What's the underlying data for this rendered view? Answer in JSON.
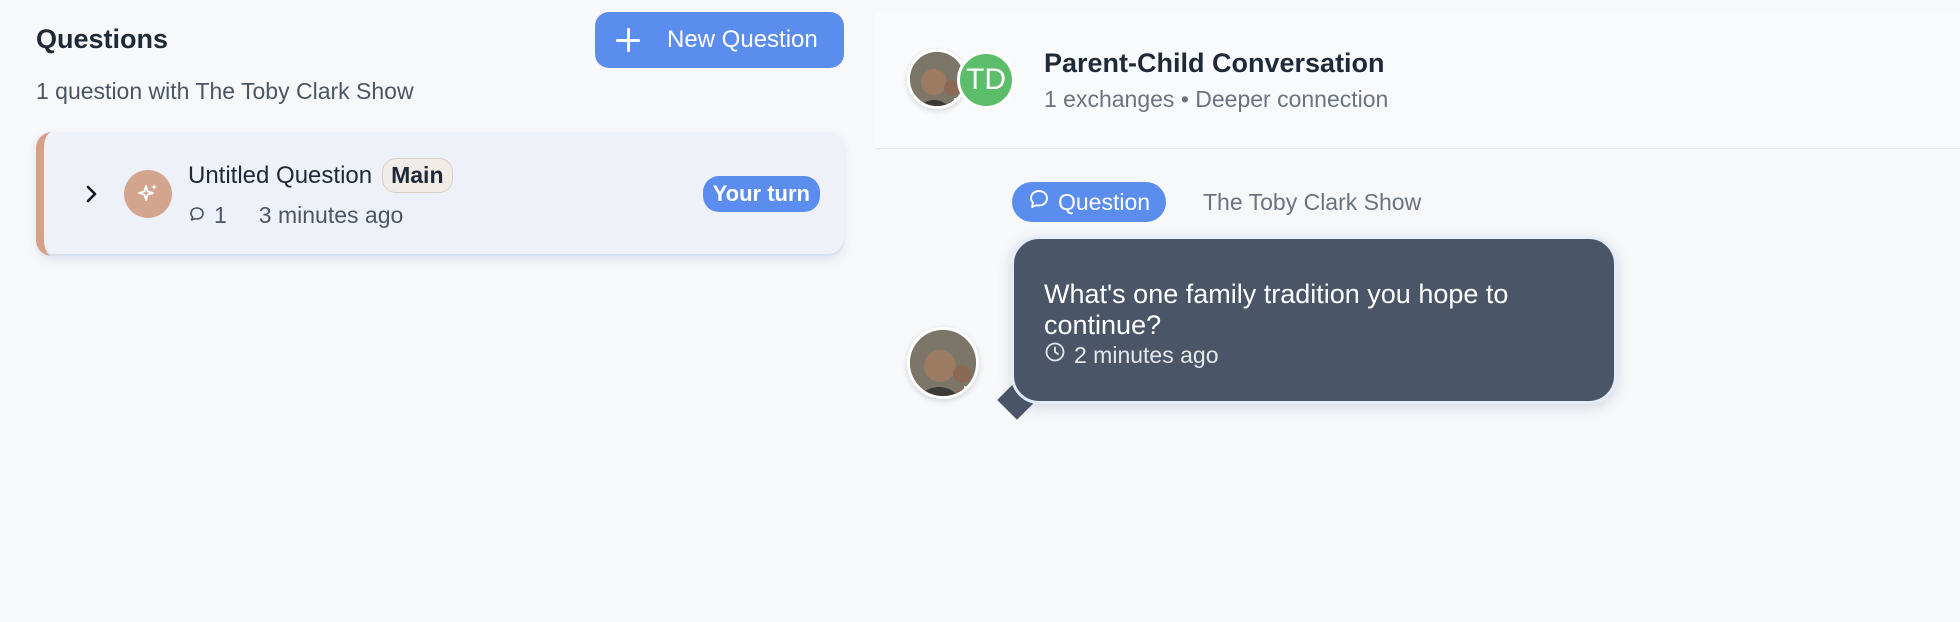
{
  "questions_panel": {
    "title": "Questions",
    "subtitle": "1 question with The Toby Clark Show",
    "new_button_label": "New Question",
    "items": [
      {
        "title": "Untitled Question",
        "badge": "Main",
        "comment_count": "1",
        "time": "3 minutes ago",
        "status": "Your turn"
      }
    ]
  },
  "conversation": {
    "title": "Parent-Child Conversation",
    "subtitle": "1 exchanges • Deeper connection",
    "partner_initials": "TD",
    "message": {
      "tag": "Question",
      "author": "The Toby Clark Show",
      "text": "What's one family tradition you hope to continue?",
      "time": "2 minutes ago"
    }
  },
  "colors": {
    "accent": "#5b8def",
    "bubble": "#4a5568",
    "question_avatar": "#d3a58f",
    "initials_avatar": "#5cbd6b"
  }
}
